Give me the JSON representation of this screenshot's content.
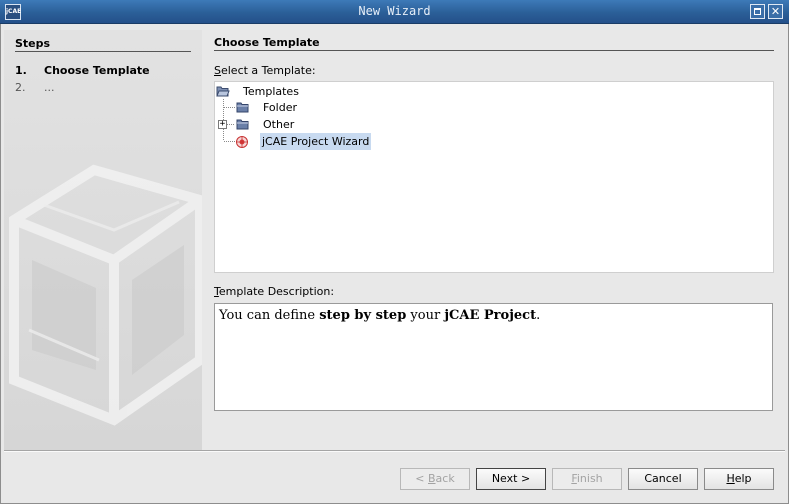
{
  "window": {
    "title": "New Wizard",
    "app_icon_text": "jCAE"
  },
  "steps": {
    "title": "Steps",
    "items": [
      {
        "num": "1.",
        "label": "Choose Template"
      },
      {
        "num": "2.",
        "label": "..."
      }
    ]
  },
  "main": {
    "title": "Choose Template",
    "select_label_mnemonic": "S",
    "select_label_rest": "elect a Template:",
    "desc_label_mnemonic": "T",
    "desc_label_rest": "emplate Description:"
  },
  "tree": {
    "root": "Templates",
    "items": [
      {
        "label": "Folder",
        "expandable": false
      },
      {
        "label": "Other",
        "expandable": true,
        "expander": "+"
      },
      {
        "label": "jCAE Project Wizard",
        "expandable": false,
        "selected": true
      }
    ]
  },
  "description": {
    "p1": "You can define ",
    "b1": "step by step",
    "p2": " your ",
    "b2": "jCAE Project",
    "p3": "."
  },
  "buttons": {
    "back_prefix": "< ",
    "back_mnemonic": "B",
    "back_rest": "ack",
    "next": "Next >",
    "finish_mnemonic": "F",
    "finish_rest": "inish",
    "cancel": "Cancel",
    "help_mnemonic": "H",
    "help_rest": "elp"
  },
  "colors": {
    "titlebar": "#2b5f98",
    "selection": "#c8daf0",
    "folder": "#6a7fa8"
  }
}
